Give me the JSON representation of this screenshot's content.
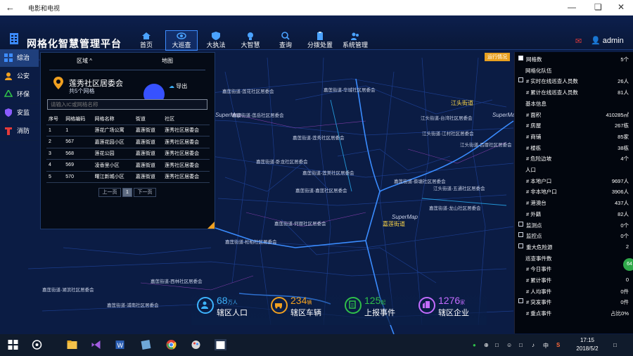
{
  "window": {
    "title": "电影和电视"
  },
  "app": {
    "title": "网格化智慧管理平台"
  },
  "nav": [
    {
      "label": "首页",
      "icon": "home-icon"
    },
    {
      "label": "大巡查",
      "icon": "eye-icon"
    },
    {
      "label": "大执法",
      "icon": "shield-icon"
    },
    {
      "label": "大智慧",
      "icon": "bulb-icon"
    },
    {
      "label": "查询",
      "icon": "search-icon"
    },
    {
      "label": "分拨处置",
      "icon": "clipboard-icon"
    },
    {
      "label": "系统管理",
      "icon": "people-icon"
    }
  ],
  "user": {
    "name": "admin"
  },
  "sidebar": [
    {
      "label": "综治",
      "color": "#3d8cff"
    },
    {
      "label": "公安",
      "color": "#f0a020"
    },
    {
      "label": "环保",
      "color": "#2fbf4a"
    },
    {
      "label": "安监",
      "color": "#8a5cff"
    },
    {
      "label": "消防",
      "color": "#e33a3a"
    }
  ],
  "panel": {
    "tab_region": "区域",
    "tab_map": "地图",
    "community": "莲秀社区居委会",
    "count": "共5个网格",
    "export": "导出",
    "search_placeholder": "请输入IC或网格名称",
    "headers": [
      "序号",
      "网格编码",
      "网格名称",
      "街道",
      "社区"
    ],
    "rows": [
      [
        "1",
        "1",
        "莲花广场公寓",
        "嘉莲街道",
        "莲秀社区居委会"
      ],
      [
        "2",
        "567",
        "嘉莲花园小区",
        "嘉莲街道",
        "莲秀社区居委会"
      ],
      [
        "3",
        "568",
        "莲花公园",
        "嘉莲街道",
        "莲秀社区居委会"
      ],
      [
        "4",
        "569",
        "凌香里小区",
        "嘉莲街道",
        "莲秀社区居委会"
      ],
      [
        "5",
        "570",
        "曙江新城小区",
        "嘉莲街道",
        "莲秀社区居委会"
      ]
    ],
    "prev": "上一页",
    "page": "1",
    "next": "下一页"
  },
  "orange_tag": "运行情况",
  "right_panel": {
    "rows": [
      {
        "label": "网格数",
        "value": "5个",
        "checkbox": "on",
        "type": "item"
      },
      {
        "label": "网格化队伍",
        "value": "",
        "type": "section"
      },
      {
        "label": "# 实时在线巡查人员数",
        "value": "26人",
        "checkbox": "off",
        "type": "item"
      },
      {
        "label": "# 累计在线巡查人员数",
        "value": "81人",
        "type": "item"
      },
      {
        "label": "基本信息",
        "value": "",
        "type": "section"
      },
      {
        "label": "# 面积",
        "value": "410285㎡",
        "type": "item"
      },
      {
        "label": "# 房屋",
        "value": "267栋",
        "type": "item"
      },
      {
        "label": "# 商铺",
        "value": "85家",
        "type": "item"
      },
      {
        "label": "# 楼栋",
        "value": "38栋",
        "type": "item"
      },
      {
        "label": "# 危险边坡",
        "value": "4个",
        "type": "item"
      },
      {
        "label": "人口",
        "value": "",
        "type": "section"
      },
      {
        "label": "# 本地户口",
        "value": "9697人",
        "type": "item"
      },
      {
        "label": "# 非本地户口",
        "value": "3906人",
        "type": "item"
      },
      {
        "label": "# 港澳台",
        "value": "437人",
        "type": "item"
      },
      {
        "label": "# 外籍",
        "value": "82人",
        "type": "item"
      },
      {
        "label": "监测点",
        "value": "0个",
        "checkbox": "off",
        "type": "item"
      },
      {
        "label": "监控点",
        "value": "0个",
        "checkbox": "off",
        "type": "item"
      },
      {
        "label": "重大危险源",
        "value": "2",
        "checkbox": "off",
        "type": "item"
      },
      {
        "label": "巡查事件数",
        "value": "",
        "type": "section"
      },
      {
        "label": "# 今日事件",
        "value": "0",
        "type": "item"
      },
      {
        "label": "# 累计事件",
        "value": "0",
        "type": "item"
      },
      {
        "label": "# 人均事件",
        "value": "0件",
        "type": "item"
      },
      {
        "label": "# 突发事件",
        "value": "0件",
        "checkbox": "off",
        "type": "item"
      },
      {
        "label": "# 重点事件",
        "value": "占比0%",
        "type": "item"
      }
    ],
    "badge": "64"
  },
  "stats": [
    {
      "num": "68",
      "unit": "万人",
      "label": "辖区人口",
      "color": "#3db4ff"
    },
    {
      "num": "234",
      "unit": "辆",
      "label": "辖区车辆",
      "color": "#f0a020"
    },
    {
      "num": "125",
      "unit": "起",
      "label": "上报事件",
      "color": "#2fbf4a"
    },
    {
      "num": "1276",
      "unit": "家",
      "label": "辖区企业",
      "color": "#c46cff"
    }
  ],
  "map": {
    "poi": [
      "江头街道",
      "嘉莲街道"
    ],
    "labels": [
      "嘉莲街道-莲花社区居委会",
      "嘉莲街道-华城社区居委会",
      "嘉莲街道-莲岳社区居委会",
      "嘉莲街道-莲秀社区居委会",
      "嘉莲街道-卧龙社区居委会",
      "嘉莲街道-莲美社区居委会",
      "嘉莲街道-嘉莲社区居委会",
      "嘉莲街道-龙山社区居委会",
      "嘉莲街道-松柏社区居委会",
      "嘉莲街道-西林社区居委会",
      "嘉莲街道-湖滨社区居委会",
      "嘉莲街道-何厝社区居委会",
      "嘉莲街道-浦南社区居委会",
      "嘉莲街道-蔡塘社区居委会",
      "江头街道-台湾社区居委会",
      "江头街道-江村社区居委会",
      "江头街道-五通社区居委会",
      "江头街道-吕厝社区居委会"
    ],
    "supermap": "SuperMap"
  },
  "taskbar": {
    "time": "17:15",
    "date": "2018/5/2",
    "ime": "中",
    "lang": "S"
  }
}
